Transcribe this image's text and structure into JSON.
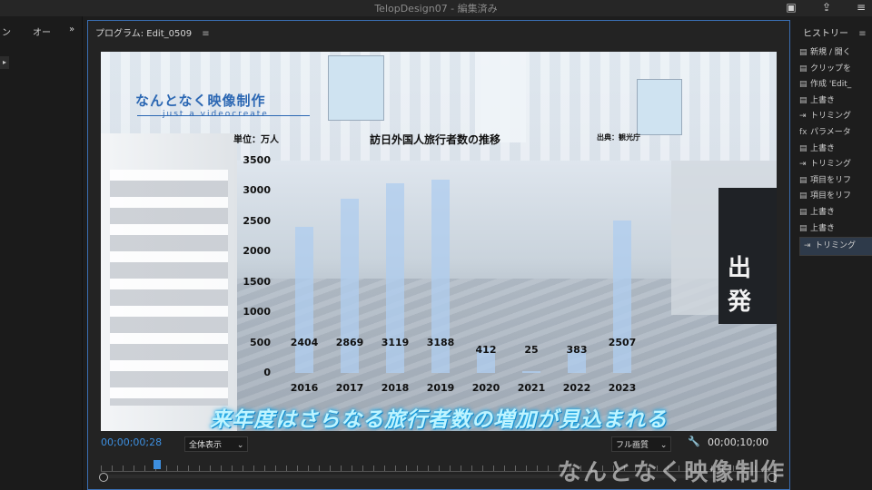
{
  "window": {
    "title": "TelopDesign07 - 編集済み"
  },
  "toolbar_icons": [
    "panel-icon",
    "share-icon",
    "menu-icon"
  ],
  "left_panel": {
    "tab1": "ン",
    "tab2": "オー",
    "more": "»"
  },
  "program_monitor": {
    "title": "プログラム: Edit_0509",
    "menu_icon": "≡",
    "timecode_current": "00;00;00;28",
    "zoom_label": "全体表示",
    "quality_label": "フル画質",
    "timecode_total": "00;00;10;00"
  },
  "video_overlay": {
    "logo_text": "なんとなく映像制作",
    "logo_sub": "just a videocreate",
    "chart_title": "訪日外国人旅行者数の推移",
    "unit_label": "単位：万人",
    "source_label": "出典：観光庁",
    "caption": "来年度はさらなる旅行者数の増加が見込まれる",
    "exit_sign": "出 発"
  },
  "chart_data": {
    "type": "bar",
    "title": "訪日外国人旅行者数の推移",
    "ylabel": "単位：万人",
    "categories": [
      "2016",
      "2017",
      "2018",
      "2019",
      "2020",
      "2021",
      "2022",
      "2023"
    ],
    "values": [
      2404,
      2869,
      3119,
      3188,
      412,
      25,
      383,
      2507
    ],
    "value_labels": [
      "2404",
      "2869",
      "3119",
      "3188",
      "412",
      "25",
      "383",
      "2507"
    ],
    "yticks": [
      "0",
      "500",
      "1000",
      "1500",
      "2000",
      "2500",
      "3000",
      "3500"
    ],
    "ylim": [
      0,
      3500
    ],
    "grid": false,
    "bar_color": "#afcdee"
  },
  "history_panel": {
    "title": "ヒストリー",
    "menu_icon": "≡",
    "items": [
      {
        "icon": "list-icon",
        "label": "新規 / 開く"
      },
      {
        "icon": "list-icon",
        "label": "クリップを"
      },
      {
        "icon": "list-icon",
        "label": "作成 'Edit_"
      },
      {
        "icon": "list-icon",
        "label": "上書き"
      },
      {
        "icon": "trim-icon",
        "label": "トリミング"
      },
      {
        "icon": "fx-icon",
        "label": "パラメータ"
      },
      {
        "icon": "list-icon",
        "label": "上書き"
      },
      {
        "icon": "trim-icon",
        "label": "トリミング"
      },
      {
        "icon": "list-icon",
        "label": "項目をリフ"
      },
      {
        "icon": "list-icon",
        "label": "項目をリフ"
      },
      {
        "icon": "list-icon",
        "label": "上書き"
      },
      {
        "icon": "list-icon",
        "label": "上書き"
      },
      {
        "icon": "trim-icon",
        "label": "トリミング"
      }
    ]
  },
  "watermark": "なんとなく映像制作"
}
